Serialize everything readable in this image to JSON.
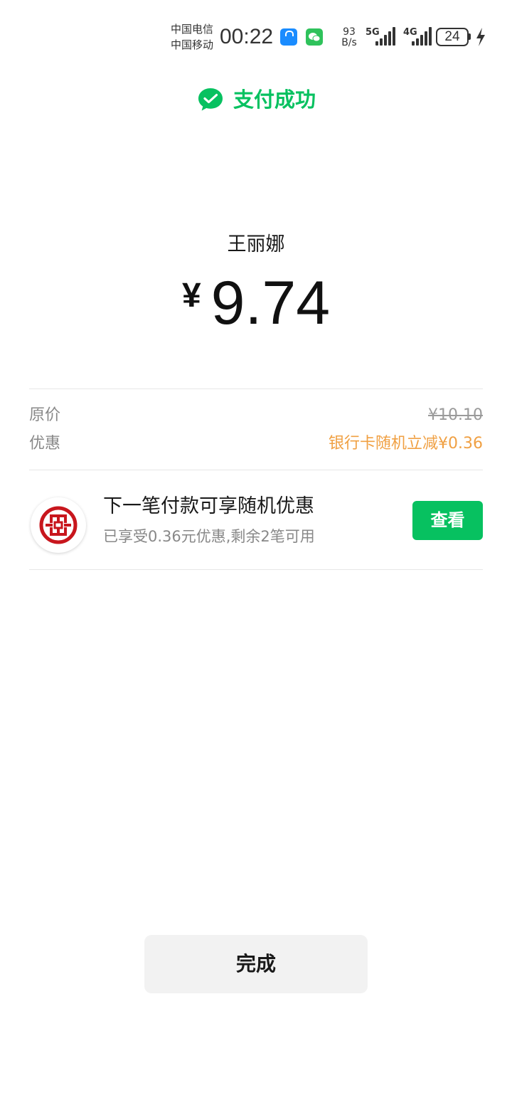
{
  "status_bar": {
    "carrier_1": "中国电信",
    "carrier_2": "中国移动",
    "time": "00:22",
    "net_speed_value": "93",
    "net_speed_unit": "B/s",
    "network_1": "5G",
    "network_2": "4G",
    "battery_level": "24"
  },
  "header": {
    "title": "支付成功",
    "icon": "wechat-pay-check-icon"
  },
  "payment": {
    "payee": "王丽娜",
    "currency_symbol": "¥",
    "amount": "9.74"
  },
  "details": {
    "original_label": "原价",
    "original_value": "¥10.10",
    "discount_label": "优惠",
    "discount_value": "银行卡随机立减¥0.36"
  },
  "promo": {
    "bank_icon": "icbc-logo-icon",
    "title": "下一笔付款可享随机优惠",
    "subtitle": "已享受0.36元优惠,剩余2笔可用",
    "button_label": "查看"
  },
  "footer": {
    "done_label": "完成"
  },
  "colors": {
    "brand_green": "#07c160",
    "discount_orange": "#f0a043",
    "bank_red": "#c8161d",
    "button_gray": "#f2f2f2"
  }
}
